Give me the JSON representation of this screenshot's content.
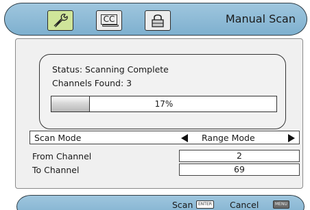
{
  "header": {
    "title": "Manual Scan",
    "icons": [
      "setup-wrench-icon",
      "closed-caption-icon",
      "lock-icon"
    ],
    "cc_label": "CC",
    "active_icon_color": "#cfe59a"
  },
  "status": {
    "status_text": "Status: Scanning Complete",
    "channels_found_text": "Channels Found: 3",
    "progress_percent": 17,
    "progress_label": "17%"
  },
  "settings": {
    "scan_mode_label": "Scan Mode",
    "scan_mode_value": "Range Mode",
    "from_channel_label": "From Channel",
    "from_channel_value": "2",
    "to_channel_label": "To Channel",
    "to_channel_value": "69"
  },
  "footer": {
    "scan_label": "Scan",
    "enter_key": "ENTER",
    "cancel_label": "Cancel",
    "menu_key": "MENU"
  }
}
